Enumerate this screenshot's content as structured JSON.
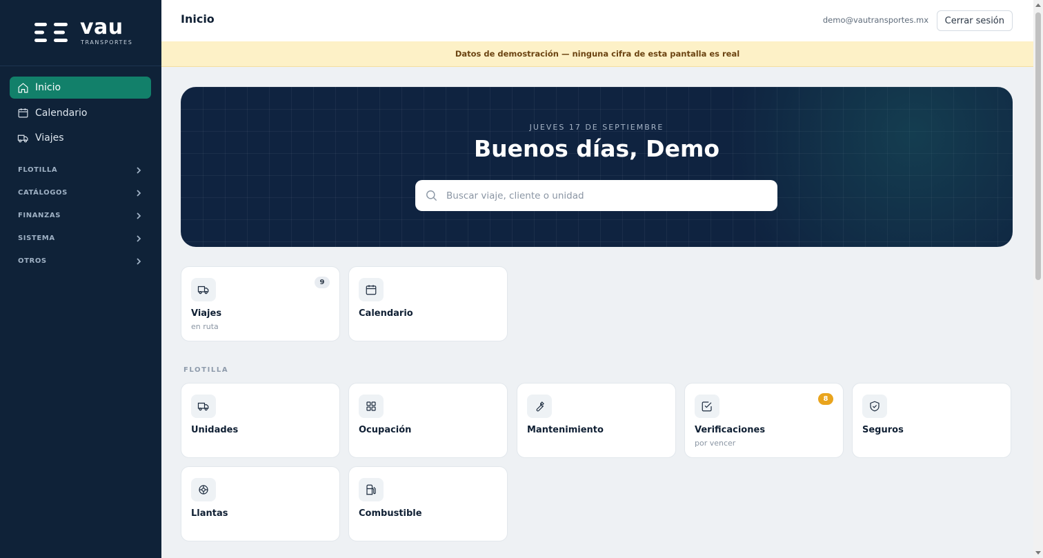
{
  "brand": {
    "name": "vau",
    "subtitle": "TRANSPORTES"
  },
  "sidebar": {
    "items": [
      {
        "label": "Inicio",
        "icon": "home-icon",
        "active": true
      },
      {
        "label": "Calendario",
        "icon": "calendar-icon",
        "active": false
      },
      {
        "label": "Viajes",
        "icon": "truck-icon",
        "active": false
      }
    ],
    "groups": [
      {
        "label": "FLOTILLA"
      },
      {
        "label": "CATÁLOGOS"
      },
      {
        "label": "FINANZAS"
      },
      {
        "label": "SISTEMA"
      },
      {
        "label": "OTROS"
      }
    ]
  },
  "header": {
    "title": "Inicio",
    "user_email": "demo@vautransportes.mx",
    "logout_label": "Cerrar sesión"
  },
  "banner": {
    "text": "Datos de demostración — ninguna cifra de esta pantalla es real"
  },
  "hero": {
    "date": "JUEVES 17 DE SEPTIEMBRE",
    "greeting": "Buenos días, Demo",
    "search_placeholder": "Buscar viaje, cliente o unidad"
  },
  "quick_cards": [
    {
      "title": "Viajes",
      "subtitle": "en ruta",
      "badge": "9",
      "icon": "truck-icon"
    },
    {
      "title": "Calendario",
      "subtitle": "",
      "badge": "",
      "icon": "calendar-icon"
    }
  ],
  "fleet": {
    "label": "FLOTILLA",
    "cards": [
      {
        "title": "Unidades",
        "subtitle": "",
        "badge": "",
        "icon": "truck-icon"
      },
      {
        "title": "Ocupación",
        "subtitle": "",
        "badge": "",
        "icon": "grid-icon"
      },
      {
        "title": "Mantenimiento",
        "subtitle": "",
        "badge": "",
        "icon": "wrench-icon"
      },
      {
        "title": "Verificaciones",
        "subtitle": "por vencer",
        "badge": "8",
        "icon": "check-square-icon"
      },
      {
        "title": "Seguros",
        "subtitle": "",
        "badge": "",
        "icon": "shield-icon"
      },
      {
        "title": "Llantas",
        "subtitle": "",
        "badge": "",
        "icon": "tire-icon"
      },
      {
        "title": "Combustible",
        "subtitle": "",
        "badge": "",
        "icon": "fuel-icon"
      }
    ]
  },
  "colors": {
    "sidebar_bg": "#0f2238",
    "accent": "#12806a",
    "banner_bg": "#fdf1c7",
    "hero_bg": "#0f2340",
    "badge_amber": "#e9a41d"
  }
}
